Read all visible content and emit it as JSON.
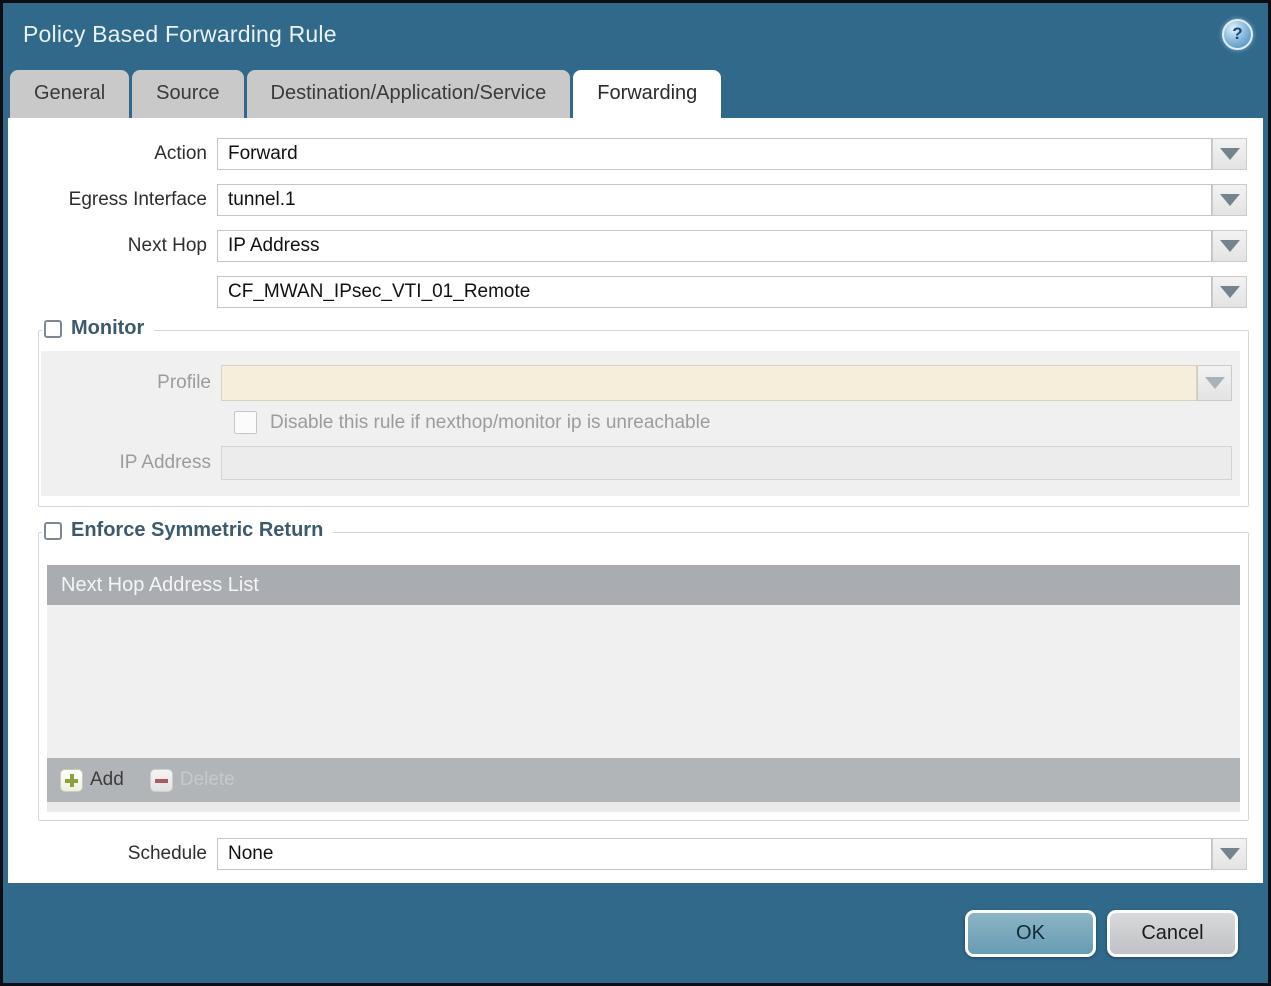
{
  "dialog": {
    "title": "Policy Based Forwarding Rule"
  },
  "tabs": [
    {
      "label": "General",
      "active": false
    },
    {
      "label": "Source",
      "active": false
    },
    {
      "label": "Destination/Application/Service",
      "active": false
    },
    {
      "label": "Forwarding",
      "active": true
    }
  ],
  "form": {
    "action": {
      "label": "Action",
      "value": "Forward"
    },
    "egress_interface": {
      "label": "Egress Interface",
      "value": "tunnel.1"
    },
    "next_hop": {
      "label": "Next Hop",
      "value": "IP Address"
    },
    "next_hop_address": {
      "value": "CF_MWAN_IPsec_VTI_01_Remote"
    },
    "schedule": {
      "label": "Schedule",
      "value": "None"
    }
  },
  "monitor": {
    "title": "Monitor",
    "checked": false,
    "profile": {
      "label": "Profile",
      "value": ""
    },
    "disable_rule_label": "Disable this rule if nexthop/monitor ip is unreachable",
    "disable_rule_checked": false,
    "ip_address": {
      "label": "IP Address",
      "value": ""
    }
  },
  "enforce_symmetric_return": {
    "title": "Enforce Symmetric Return",
    "checked": false,
    "table": {
      "header": "Next Hop Address List",
      "rows": []
    },
    "add_label": "Add",
    "delete_label": "Delete",
    "delete_enabled": false
  },
  "footer": {
    "ok_label": "OK",
    "cancel_label": "Cancel"
  },
  "icons": {
    "help": "help-icon",
    "dropdown": "chevron-down-icon",
    "add": "plus-icon",
    "delete": "minus-icon"
  },
  "colors": {
    "titlebar": "#31698b",
    "tab_inactive": "#c9c9c9",
    "content": "#ffffff",
    "disabled_profile_field": "#f6eedb",
    "table_header": "#a9adb2",
    "ok_button": "#679cb3",
    "cancel_button": "#c0c2c5",
    "group_title": "#3c5a6d"
  }
}
